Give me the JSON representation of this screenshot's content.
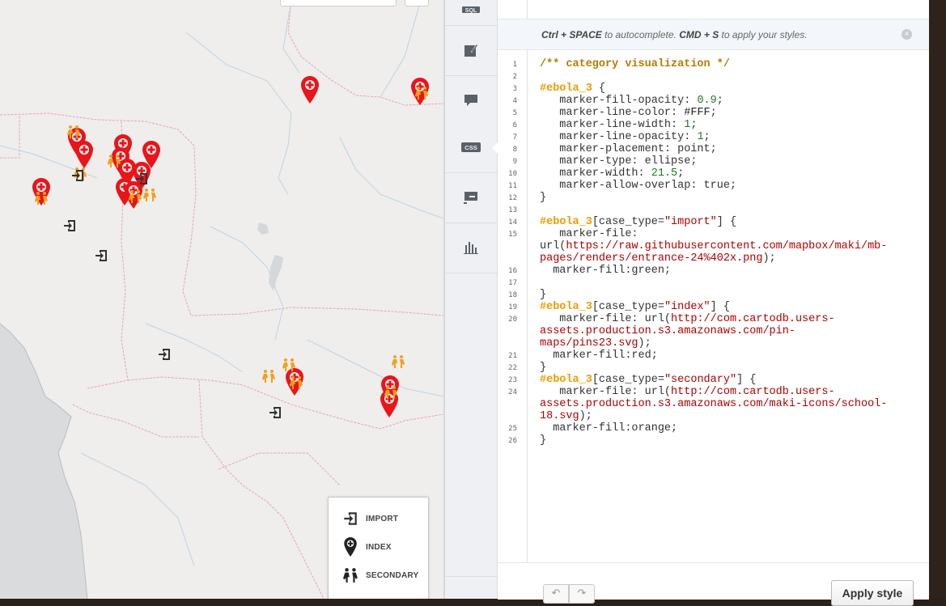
{
  "colors": {
    "index_marker": "#e8151b",
    "secondary_marker": "#f1a01d",
    "import_marker": "#333333",
    "map_background": "#efeeec",
    "selector": "#f39a00",
    "comment": "#b97a00",
    "string": "#b10000"
  },
  "map": {
    "legend": [
      {
        "icon": "entrance-icon",
        "label": "IMPORT"
      },
      {
        "icon": "pin-cross-icon",
        "label": "INDEX"
      },
      {
        "icon": "school-children-icon",
        "label": "SECONDARY"
      }
    ]
  },
  "sidebar": {
    "tools": [
      {
        "name": "sql-tool",
        "icon": "sql-icon",
        "label": "SQL"
      },
      {
        "name": "wizard-tool",
        "icon": "paintbrush-icon",
        "label": ""
      },
      {
        "name": "infowindow-tool",
        "icon": "speech-bubble-icon",
        "label": ""
      },
      {
        "name": "css-tool",
        "icon": "css-icon",
        "label": "CSS"
      },
      {
        "name": "legend-tool",
        "icon": "legend-icon",
        "label": ""
      },
      {
        "name": "filters-tool",
        "icon": "bar-chart-icon",
        "label": ""
      }
    ]
  },
  "editor": {
    "hint": {
      "key1": "Ctrl + SPACE",
      "text1": " to autocomplete. ",
      "key2": "CMD + S",
      "text2": " to apply your styles."
    },
    "line_numbers": [
      "1",
      "2",
      "3",
      "4",
      "5",
      "6",
      "7",
      "8",
      "9",
      "10",
      "11",
      "12",
      "13",
      "14",
      "15",
      "16",
      "17",
      "18",
      "19",
      "20",
      "21",
      "22",
      "23",
      "24",
      "25",
      "26"
    ],
    "code_lines": [
      [
        {
          "c": "c-comment",
          "t": "/** category visualization */"
        }
      ],
      [],
      [
        {
          "c": "c-sel",
          "t": "#ebola_3"
        },
        {
          "c": "c-punc",
          "t": " {"
        }
      ],
      [
        {
          "c": "c-prop",
          "t": "   marker-fill-opacity: "
        },
        {
          "c": "c-num",
          "t": "0.9"
        },
        {
          "c": "c-punc",
          "t": ";"
        }
      ],
      [
        {
          "c": "c-prop",
          "t": "   marker-line-color: "
        },
        {
          "c": "c-hex",
          "t": "#FFF"
        },
        {
          "c": "c-punc",
          "t": ";"
        }
      ],
      [
        {
          "c": "c-prop",
          "t": "   marker-line-width: "
        },
        {
          "c": "c-num",
          "t": "1"
        },
        {
          "c": "c-punc",
          "t": ";"
        }
      ],
      [
        {
          "c": "c-prop",
          "t": "   marker-line-opacity: "
        },
        {
          "c": "c-num",
          "t": "1"
        },
        {
          "c": "c-punc",
          "t": ";"
        }
      ],
      [
        {
          "c": "c-prop",
          "t": "   marker-placement: point;"
        }
      ],
      [
        {
          "c": "c-prop",
          "t": "   marker-type: ellipse;"
        }
      ],
      [
        {
          "c": "c-prop",
          "t": "   marker-width: "
        },
        {
          "c": "c-num",
          "t": "21.5"
        },
        {
          "c": "c-punc",
          "t": ";"
        }
      ],
      [
        {
          "c": "c-prop",
          "t": "   marker-allow-overlap: true;"
        }
      ],
      [
        {
          "c": "c-punc",
          "t": "}"
        }
      ],
      [],
      [
        {
          "c": "c-sel",
          "t": "#ebola_3"
        },
        {
          "c": "c-punc",
          "t": "[case_type="
        },
        {
          "c": "c-str",
          "t": "\"import\""
        },
        {
          "c": "c-punc",
          "t": "] {"
        }
      ],
      [
        {
          "c": "c-prop",
          "t": "   marker-file:"
        }
      ],
      [
        {
          "c": "c-prop",
          "t": "url("
        },
        {
          "c": "c-url",
          "t": "https://raw.githubusercontent.com/mapbox/maki/mb-"
        }
      ],
      [
        {
          "c": "c-url",
          "t": "pages/renders/entrance-24%402x.png"
        },
        {
          "c": "c-punc",
          "t": ");"
        }
      ],
      [
        {
          "c": "c-prop",
          "t": "  marker-fill:green;"
        }
      ],
      [],
      [
        {
          "c": "c-punc",
          "t": "}"
        }
      ],
      [
        {
          "c": "c-sel",
          "t": "#ebola_3"
        },
        {
          "c": "c-punc",
          "t": "[case_type="
        },
        {
          "c": "c-str",
          "t": "\"index\""
        },
        {
          "c": "c-punc",
          "t": "] {"
        }
      ],
      [
        {
          "c": "c-prop",
          "t": "   marker-file: url("
        },
        {
          "c": "c-url",
          "t": "http://com.cartodb.users-"
        }
      ],
      [
        {
          "c": "c-url",
          "t": "assets.production.s3.amazonaws.com/pin-"
        }
      ],
      [
        {
          "c": "c-url",
          "t": "maps/pins23.svg"
        },
        {
          "c": "c-punc",
          "t": ");"
        }
      ],
      [
        {
          "c": "c-prop",
          "t": "  marker-fill:red;"
        }
      ],
      [
        {
          "c": "c-punc",
          "t": "}"
        }
      ],
      [
        {
          "c": "c-sel",
          "t": "#ebola_3"
        },
        {
          "c": "c-punc",
          "t": "[case_type="
        },
        {
          "c": "c-str",
          "t": "\"secondary\""
        },
        {
          "c": "c-punc",
          "t": "] {"
        }
      ],
      [
        {
          "c": "c-prop",
          "t": "   marker-file: url("
        },
        {
          "c": "c-url",
          "t": "http://com.cartodb.users-"
        }
      ],
      [
        {
          "c": "c-url",
          "t": "assets.production.s3.amazonaws.com/maki-icons/school-"
        }
      ],
      [
        {
          "c": "c-url",
          "t": "18.svg"
        },
        {
          "c": "c-punc",
          "t": ");"
        }
      ],
      [
        {
          "c": "c-prop",
          "t": "  marker-fill:orange;"
        }
      ],
      [
        {
          "c": "c-punc",
          "t": "}"
        }
      ]
    ],
    "apply_label": "Apply style",
    "undo_icon": "undo-icon",
    "redo_icon": "redo-icon"
  }
}
